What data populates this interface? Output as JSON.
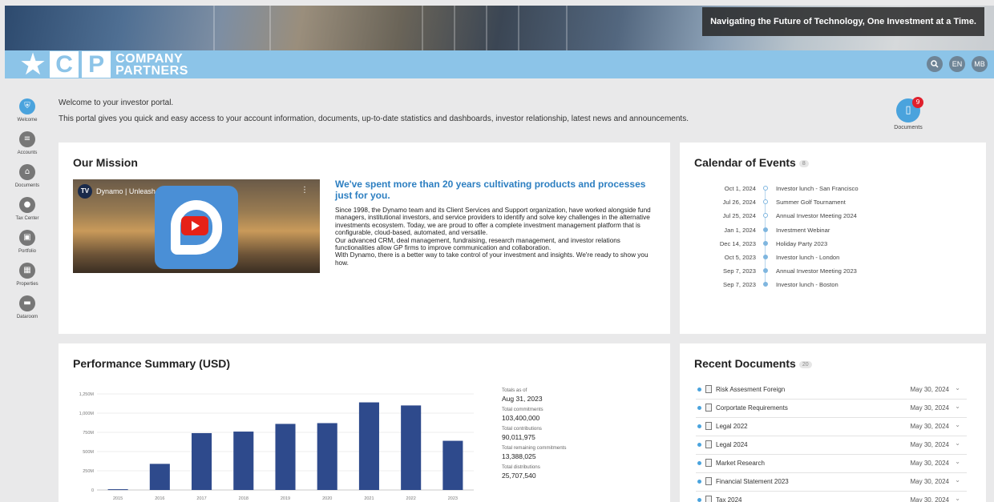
{
  "banner": {
    "tagline": "Navigating the Future of Technology, One Investment at a Time."
  },
  "header": {
    "logo_letters": [
      "C",
      "P"
    ],
    "logo_line1": "COMPANY",
    "logo_line2": "PARTNERS",
    "language": "EN",
    "user_initials": "MB"
  },
  "sidebar": {
    "items": [
      {
        "label": "Welcome",
        "icon": "shield-icon"
      },
      {
        "label": "Accounts",
        "icon": "coins-icon"
      },
      {
        "label": "Documents",
        "icon": "home-icon"
      },
      {
        "label": "Tax Center",
        "icon": "person-icon"
      },
      {
        "label": "Portfolio",
        "icon": "portfolio-icon"
      },
      {
        "label": "Properties",
        "icon": "building-icon"
      },
      {
        "label": "Dataroom",
        "icon": "folder-icon"
      }
    ]
  },
  "welcome": {
    "line1": "Welcome to your investor portal.",
    "line2": "This portal gives you quick and easy access to your account information, documents, up-to-date statistics and dashboards, investor relationship, latest news and announcements."
  },
  "documents_shortcut": {
    "label": "Documents",
    "badge": "9"
  },
  "mission": {
    "title": "Our Mission",
    "video_title": "Dynamo | Unleash Your Insights",
    "video_channel_initials": "TV",
    "headline": "We've spent more than 20 years cultivating products and processes just for you.",
    "body": [
      "Since 1998, the Dynamo team and its Client Services and Support organization, have worked alongside fund managers, institutional investors, and service providers to identify and solve key challenges in the alternative investments ecosystem. Today, we are proud to offer a complete investment management platform that is configurable, cloud-based, automated, and versatile.",
      "Our advanced CRM, deal management, fundraising, research management, and investor relations functionalities allow GP firms to improve communication and collaboration.",
      "With Dynamo, there is a better way to take control of your investment and insights. We're ready to show you how."
    ]
  },
  "calendar": {
    "title": "Calendar of Events",
    "count": "8",
    "events": [
      {
        "date": "Oct 1, 2024",
        "name": "Investor lunch - San Francisco",
        "past": false
      },
      {
        "date": "Jul 26, 2024",
        "name": "Summer Golf Tournament",
        "past": false
      },
      {
        "date": "Jul 25, 2024",
        "name": "Annual Investor Meeting 2024",
        "past": false
      },
      {
        "date": "Jan 1, 2024",
        "name": "Investment Webinar",
        "past": true
      },
      {
        "date": "Dec 14, 2023",
        "name": "Holiday Party 2023",
        "past": true
      },
      {
        "date": "Oct 5, 2023",
        "name": "Investor lunch - London",
        "past": true
      },
      {
        "date": "Sep 7, 2023",
        "name": "Annual Investor Meeting 2023",
        "past": true
      },
      {
        "date": "Sep 7, 2023",
        "name": "Investor lunch - Boston",
        "past": true
      }
    ]
  },
  "performance": {
    "title": "Performance Summary (USD)",
    "totals": [
      {
        "label": "Totals as of",
        "value": "Aug 31, 2023"
      },
      {
        "label": "Total commitments",
        "value": "103,400,000"
      },
      {
        "label": "Total contributions",
        "value": "90,011,975"
      },
      {
        "label": "Total remaining commitments",
        "value": "13,388,025"
      },
      {
        "label": "Total distributions",
        "value": "25,707,540"
      }
    ]
  },
  "chart_data": {
    "type": "bar",
    "categories": [
      "2015",
      "2016",
      "2017",
      "2018",
      "2019",
      "2020",
      "2021",
      "2022",
      "2023"
    ],
    "values": [
      10,
      340,
      740,
      760,
      860,
      870,
      1140,
      1100,
      640
    ],
    "yticks": [
      "0",
      "250M",
      "500M",
      "750M",
      "1,000M",
      "1,250M"
    ],
    "ylim": [
      0,
      1250
    ],
    "bar_color": "#2e4a8c",
    "grid": true
  },
  "recent_documents": {
    "title": "Recent Documents",
    "count": "20",
    "items": [
      {
        "name": "Risk Assesment Foreign",
        "date": "May 30, 2024"
      },
      {
        "name": "Corportate Requirements",
        "date": "May 30, 2024"
      },
      {
        "name": "Legal 2022",
        "date": "May 30, 2024"
      },
      {
        "name": "Legal 2024",
        "date": "May 30, 2024"
      },
      {
        "name": "Market Research",
        "date": "May 30, 2024"
      },
      {
        "name": "Financial Statement 2023",
        "date": "May 30, 2024"
      },
      {
        "name": "Tax 2024",
        "date": "May 30, 2024"
      }
    ]
  }
}
